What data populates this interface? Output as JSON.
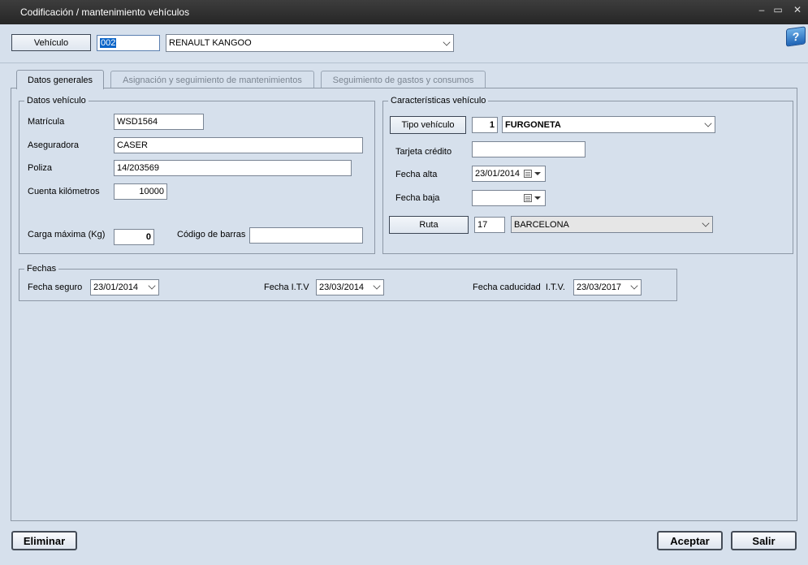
{
  "window": {
    "title": "Codificación / mantenimiento vehículos",
    "controls": {
      "minimize": "–",
      "restore": "▭",
      "close": "✕"
    }
  },
  "vehicle": {
    "button_label": "Vehículo",
    "code": "002",
    "name": "RENAULT KANGOO"
  },
  "help_icon": {
    "glyph": "?"
  },
  "tabs": [
    {
      "label": "Datos generales",
      "active": true
    },
    {
      "label": "Asignación y seguimiento de mantenimientos",
      "active": false
    },
    {
      "label": "Seguimiento de gastos y consumos",
      "active": false
    }
  ],
  "datos_vehiculo": {
    "legend": "Datos vehículo",
    "matricula_label": "Matrícula",
    "matricula": "WSD1564",
    "aseguradora_label": "Aseguradora",
    "aseguradora": "CASER",
    "poliza_label": "Poliza",
    "poliza": "14/203569",
    "km_label": "Cuenta kilómetros",
    "km": "10000",
    "carga_label": "Carga máxima (Kg)",
    "carga": "0",
    "codigo_barras_label": "Código de barras",
    "codigo_barras": ""
  },
  "caracteristicas": {
    "legend": "Características vehículo",
    "tipo_button": "Tipo vehículo",
    "tipo_code": "1",
    "tipo_name": "FURGONETA",
    "tarjeta_label": "Tarjeta crédito",
    "tarjeta": "",
    "fecha_alta_label": "Fecha alta",
    "fecha_alta": "23/01/2014",
    "fecha_baja_label": "Fecha baja",
    "fecha_baja": "",
    "ruta_button": "Ruta",
    "ruta_code": "17",
    "ruta_name": "BARCELONA"
  },
  "fechas": {
    "legend": "Fechas",
    "seguro_label": "Fecha seguro",
    "seguro": "23/01/2014",
    "itv_label": "Fecha I.T.V",
    "itv": "23/03/2014",
    "caducidad_label": "Fecha caducidad  I.T.V.",
    "caducidad": "23/03/2017"
  },
  "footer": {
    "eliminar": "Eliminar",
    "aceptar": "Aceptar",
    "salir": "Salir"
  },
  "colors": {
    "window_bg": "#d6e0ec",
    "titlebar_bg": "#2f2f2f",
    "selection": "#0a64c8"
  }
}
